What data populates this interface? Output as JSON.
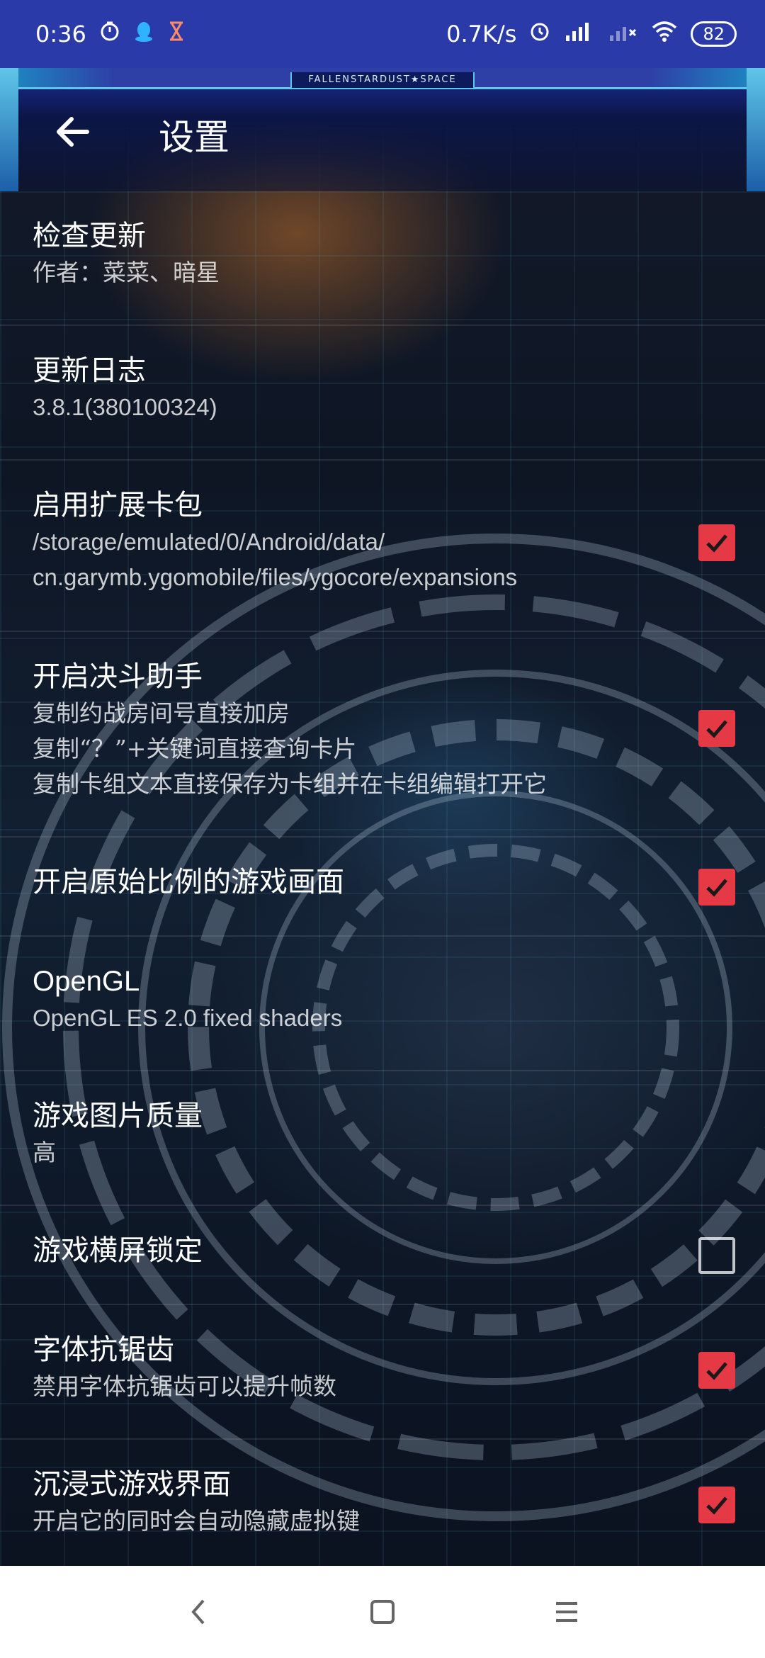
{
  "status_bar": {
    "time": "0:36",
    "net_speed": "0.7K/s",
    "battery": "82",
    "icons": [
      "timer-icon",
      "qq-icon",
      "hourglass-icon",
      "alarm-icon",
      "signal-hd-icon",
      "signal-icon",
      "wifi-icon",
      "battery-icon"
    ]
  },
  "header": {
    "banner": "FALLENSTARDUST★SPACE",
    "title": "设置"
  },
  "settings": [
    {
      "title": "检查更新",
      "subtitle": [
        "作者：菜菜、暗星"
      ],
      "checkbox": null
    },
    {
      "title": "更新日志",
      "subtitle": [
        "3.8.1(380100324)"
      ],
      "checkbox": null
    },
    {
      "title": "启用扩展卡包",
      "subtitle": [
        "/storage/emulated/0/Android/data/",
        "cn.garymb.ygomobile/files/ygocore/expansions"
      ],
      "checkbox": true
    },
    {
      "title": "开启决斗助手",
      "subtitle": [
        "复制约战房间号直接加房",
        "复制“？”+关键词直接查询卡片",
        "复制卡组文本直接保存为卡组并在卡组编辑打开它"
      ],
      "checkbox": true
    },
    {
      "title": "开启原始比例的游戏画面",
      "subtitle": [],
      "checkbox": true
    },
    {
      "title": "OpenGL",
      "subtitle": [
        "OpenGL ES 2.0 fixed shaders"
      ],
      "checkbox": null
    },
    {
      "title": "游戏图片质量",
      "subtitle": [
        "高"
      ],
      "checkbox": null
    },
    {
      "title": "游戏横屏锁定",
      "subtitle": [],
      "checkbox": false
    },
    {
      "title": "字体抗锯齿",
      "subtitle": [
        "禁用字体抗锯齿可以提升帧数"
      ],
      "checkbox": true
    },
    {
      "title": "沉浸式游戏界面",
      "subtitle": [
        "开启它的同时会自动隐藏虚拟键"
      ],
      "checkbox": true
    }
  ],
  "colors": {
    "status_bar": "#2a3aa8",
    "checkbox_on": "#e53945",
    "nav_bar": "#ffffff"
  }
}
